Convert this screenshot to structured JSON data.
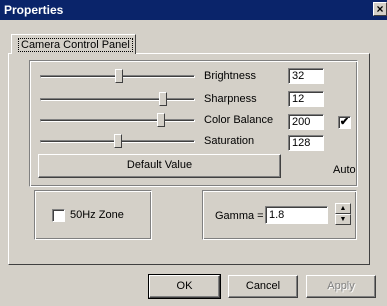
{
  "window": {
    "title": "Properties",
    "close_glyph": "×"
  },
  "tab": {
    "label": "Camera Control Panel"
  },
  "sliders": [
    {
      "label": "Brightness",
      "value": "32"
    },
    {
      "label": "Sharpness",
      "value": "12"
    },
    {
      "label": "Color Balance",
      "value": "200"
    },
    {
      "label": "Saturation",
      "value": "128"
    }
  ],
  "auto": {
    "label": "Auto",
    "checked_glyph": "✔"
  },
  "default_button": {
    "label": "Default Value"
  },
  "hz_zone": {
    "label": "50Hz Zone"
  },
  "gamma": {
    "label": "Gamma =",
    "value": "1.8",
    "up_glyph": "▲",
    "down_glyph": "▼"
  },
  "buttons": {
    "ok": "OK",
    "cancel": "Cancel",
    "apply": "Apply"
  }
}
